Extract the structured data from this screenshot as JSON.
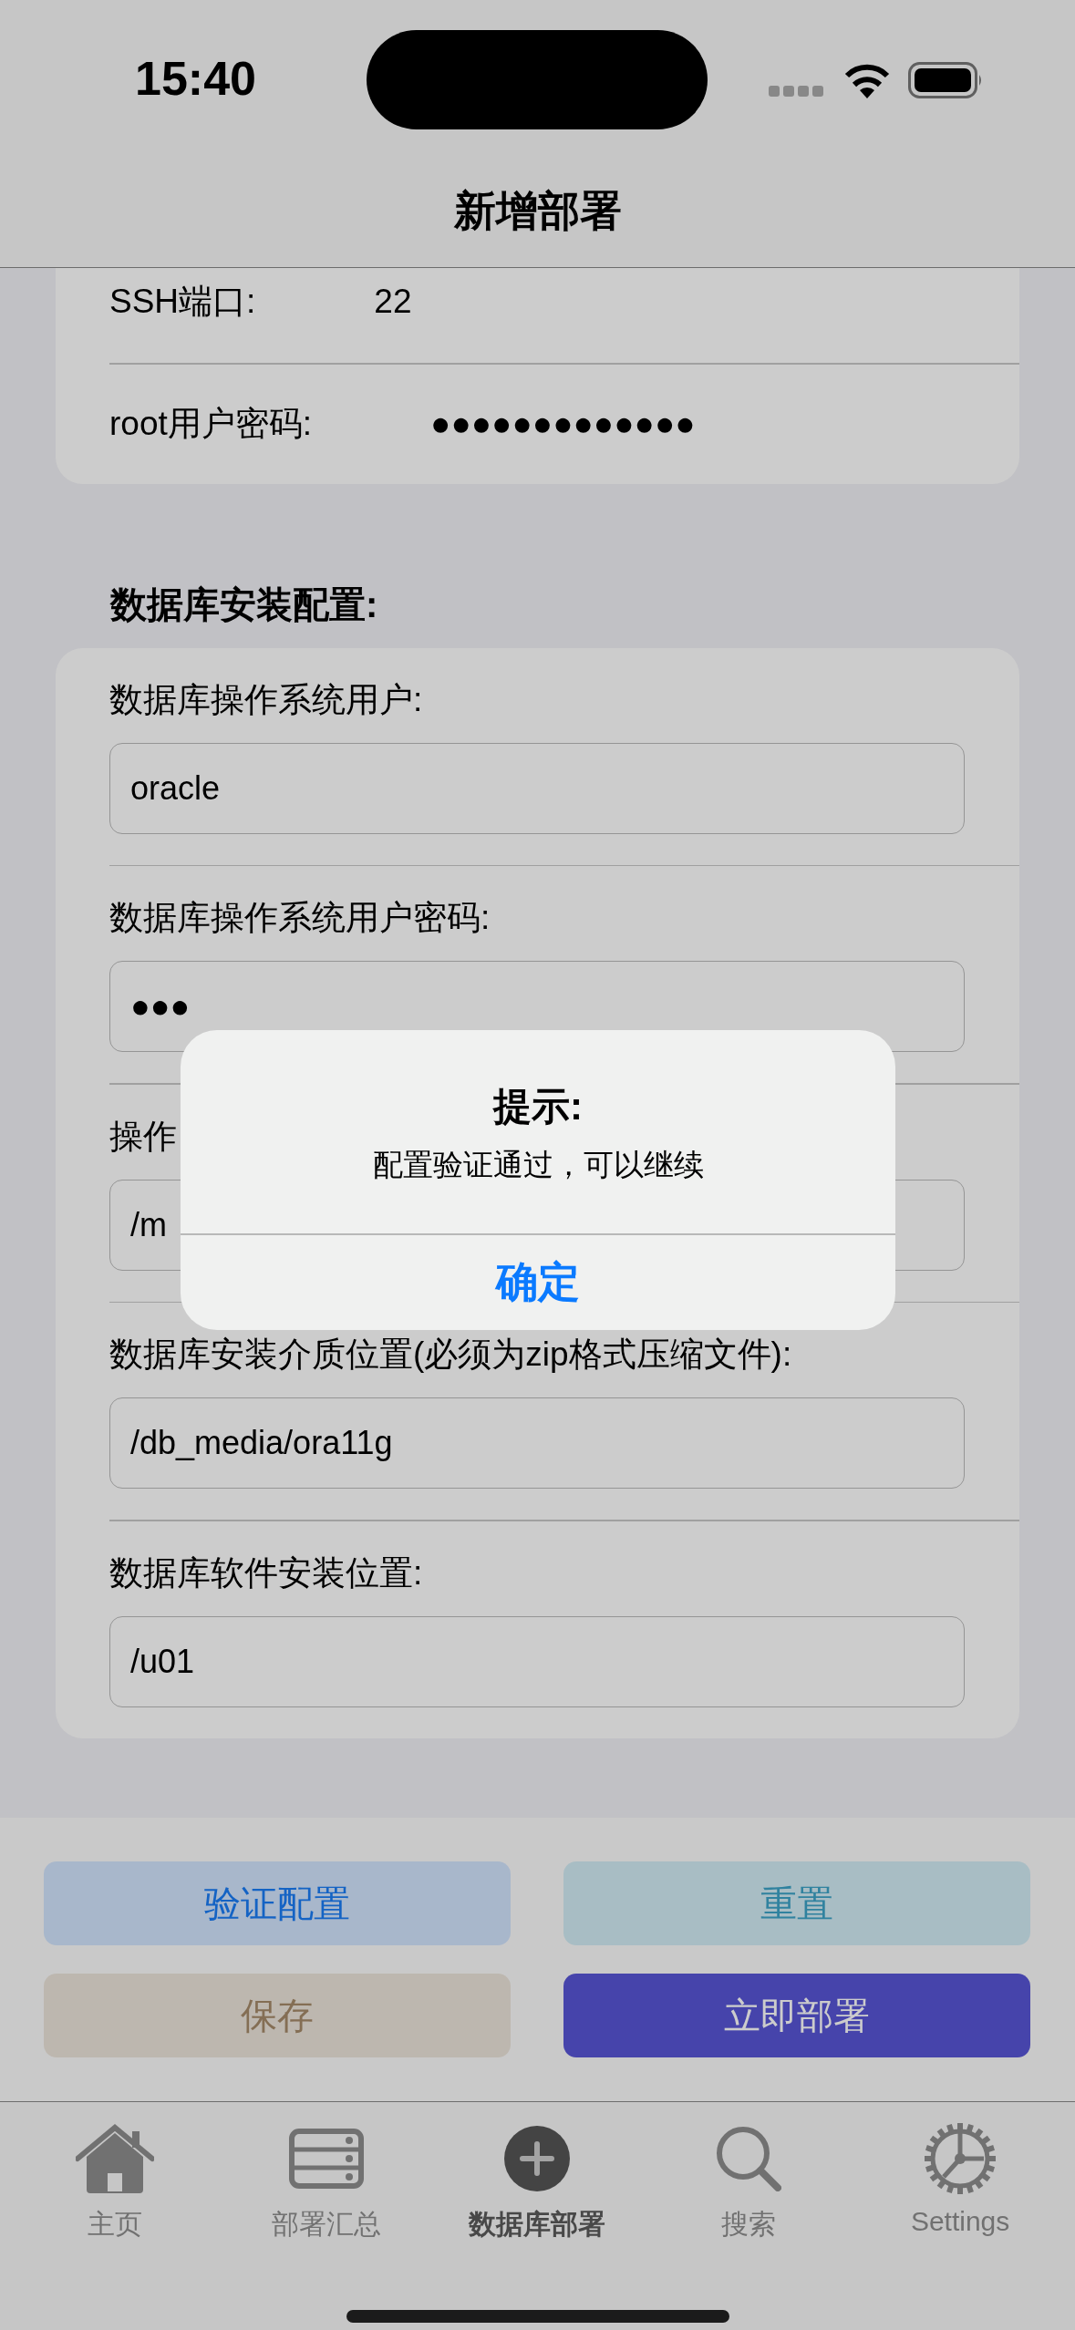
{
  "status_bar": {
    "time": "15:40"
  },
  "nav": {
    "title": "新增部署"
  },
  "server_rows": [
    {
      "label": "SSH端口:",
      "value": "22"
    },
    {
      "label": "root用户密码:",
      "value": "●●●●●●●●●●●●●"
    }
  ],
  "section_title": "数据库安装配置:",
  "db_fields": [
    {
      "label": "数据库操作系统用户:",
      "value": "oracle"
    },
    {
      "label": "数据库操作系统用户密码:",
      "value": "●●●"
    },
    {
      "label": "操作",
      "value": "/m"
    },
    {
      "label": "数据库安装介质位置(必须为zip格式压缩文件):",
      "value": "/db_media/ora11g"
    },
    {
      "label": "数据库软件安装位置:",
      "value": "/u01"
    }
  ],
  "actions": [
    {
      "label": "验证配置",
      "kind": "verify"
    },
    {
      "label": "重置",
      "kind": "reset"
    },
    {
      "label": "保存",
      "kind": "save"
    },
    {
      "label": "立即部署",
      "kind": "deploy"
    }
  ],
  "tabs": [
    {
      "label": "主页",
      "kind": "home",
      "selected": false
    },
    {
      "label": "部署汇总",
      "kind": "servers",
      "selected": false
    },
    {
      "label": "数据库部署",
      "kind": "add",
      "selected": true
    },
    {
      "label": "搜索",
      "kind": "search",
      "selected": false
    },
    {
      "label": "Settings",
      "kind": "settings",
      "selected": false
    }
  ],
  "alert": {
    "title": "提示:",
    "message": "配置验证通过，可以继续",
    "button": "确定"
  }
}
